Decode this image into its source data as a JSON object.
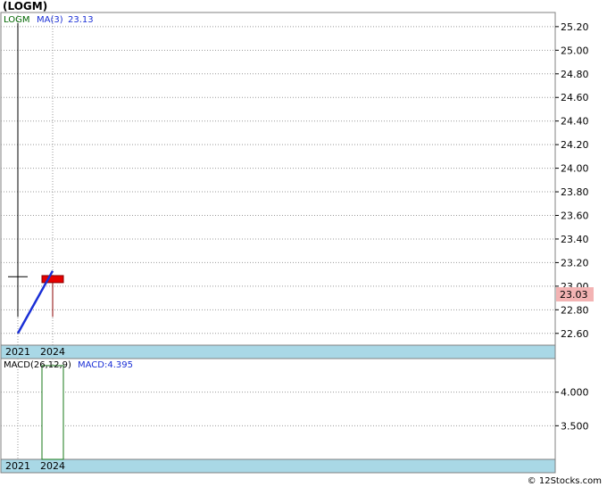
{
  "title": "(LOGM)",
  "copyright": "© 12Stocks.com",
  "colors": {
    "grid": "#999999",
    "time_band": "#a9d8e6",
    "candle": "#e60000",
    "ma_line": "#1a2fd6",
    "macd_bar": "#1a7a1a",
    "price_label_bg": "#f3b3b3",
    "ticker": "#006600",
    "ma_label": "#1a2fd6"
  },
  "chart_data": [
    {
      "type": "candlestick",
      "name": "price",
      "legend": {
        "ticker": "LOGM",
        "ma_label": "MA(3)",
        "ma_value": "23.13"
      },
      "ylim": [
        22.5,
        25.32
      ],
      "yticks": [
        "25.20",
        "25.00",
        "24.80",
        "24.60",
        "24.40",
        "24.20",
        "24.00",
        "23.80",
        "23.60",
        "23.40",
        "23.20",
        "23.00",
        "22.80",
        "22.60"
      ],
      "ytick_values": [
        25.2,
        25.0,
        24.8,
        24.6,
        24.4,
        24.2,
        24.0,
        23.8,
        23.6,
        23.4,
        23.2,
        23.0,
        22.8,
        22.6
      ],
      "xticks": [
        "2021",
        "2024"
      ],
      "last_price_label": "23.03",
      "candles": [
        {
          "period": "2021",
          "high": 25.23,
          "low": 22.74,
          "open": 23.08,
          "close": 23.08
        },
        {
          "period": "2024",
          "high": 23.08,
          "low": 22.74,
          "open": 23.09,
          "close": 23.03
        }
      ],
      "ma": {
        "name": "MA(3)",
        "points": [
          {
            "x": "start",
            "y": 22.6
          },
          {
            "x": "2024",
            "y": 23.13
          }
        ]
      }
    },
    {
      "type": "bar",
      "name": "macd",
      "legend": {
        "label": "MACD(26,12,9)",
        "value_label": "MACD:4.395"
      },
      "ylim": [
        3.0,
        4.5
      ],
      "yticks": [
        "4.000",
        "3.500"
      ],
      "ytick_values": [
        4.0,
        3.5
      ],
      "xticks": [
        "2021",
        "2024"
      ],
      "bars": [
        {
          "period": "2024",
          "value": 4.395
        }
      ]
    }
  ]
}
